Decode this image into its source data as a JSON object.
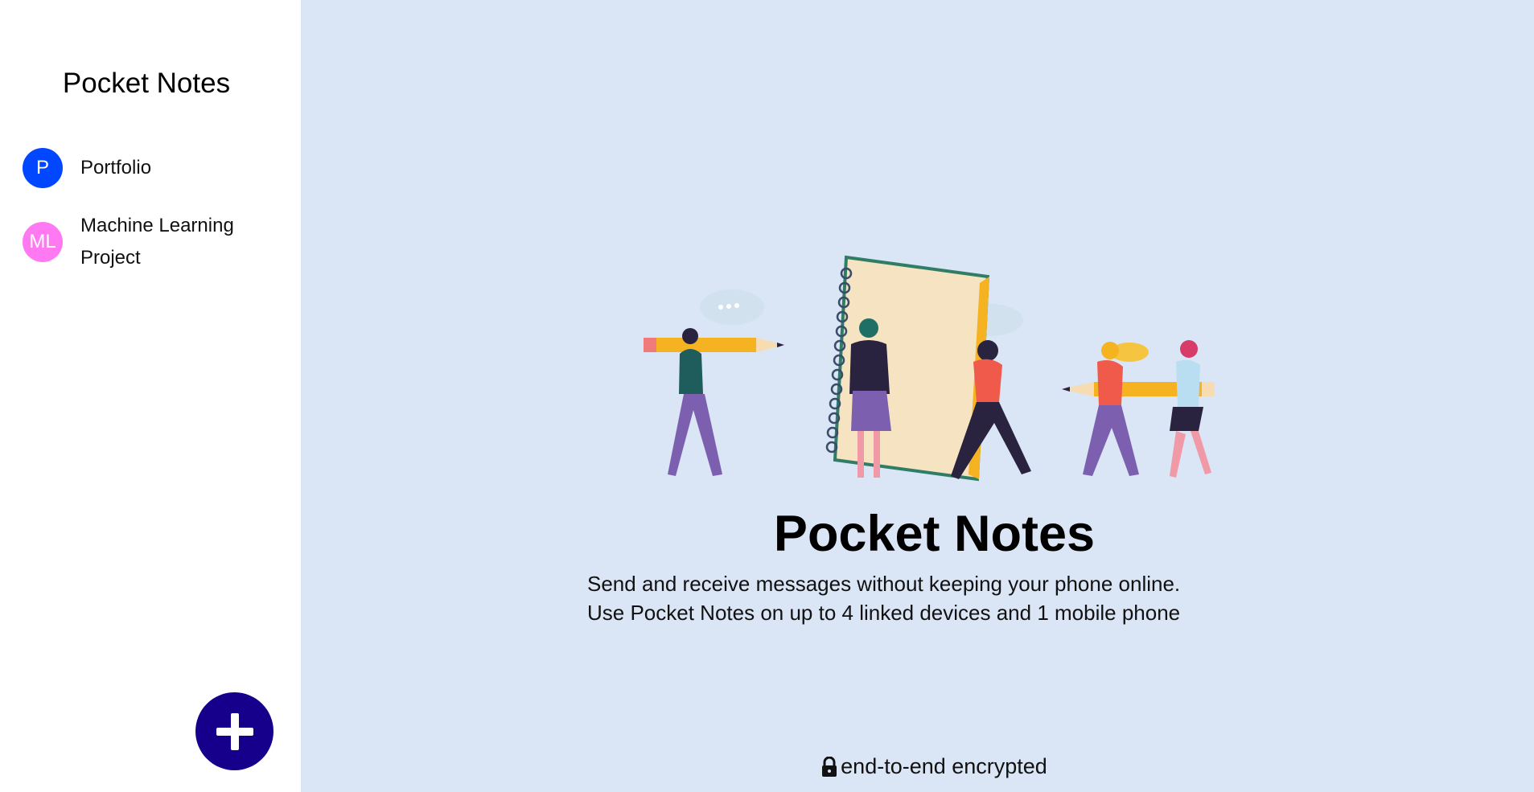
{
  "sidebar": {
    "title": "Pocket Notes",
    "groups": [
      {
        "initials": "P",
        "name": "Portfolio",
        "color": "#0047ff"
      },
      {
        "initials": "ML",
        "name": "Machine Learning Project",
        "color": "#ff79f2"
      }
    ],
    "add_button_icon": "plus-icon",
    "add_button_color": "#16008b"
  },
  "main": {
    "background": "#dae5f5",
    "title": "Pocket Notes",
    "subtitle_lines": [
      "Send and receive messages without keeping your phone online.",
      "Use Pocket Notes on up to 4 linked devices and 1 mobile phone"
    ],
    "footer_icon": "lock-icon",
    "footer_text": "end-to-end encrypted"
  }
}
